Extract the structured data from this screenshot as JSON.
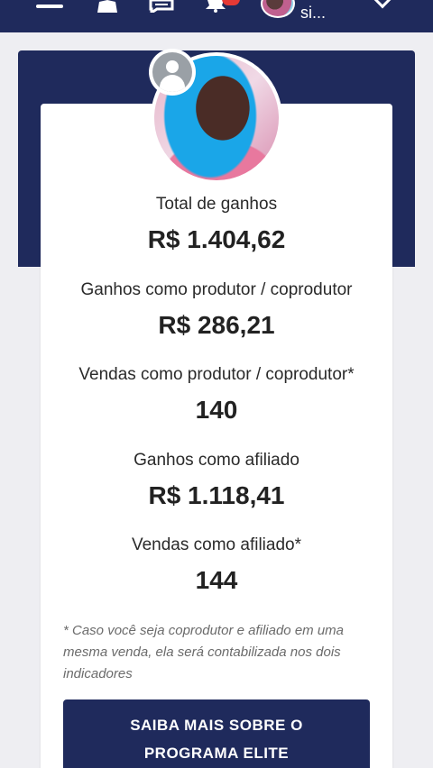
{
  "topbar": {
    "username": "si...",
    "icons": [
      "menu-icon",
      "people-icon",
      "chat-icon",
      "bell-icon",
      "chevron-down-icon"
    ],
    "colors": {
      "bar": "#1f2a5c",
      "notification": "#e53935"
    }
  },
  "stats": [
    {
      "label": "Total de ganhos",
      "value": "R$ 1.404,62"
    },
    {
      "label": "Ganhos como produtor / coprodutor",
      "value": "R$ 286,21"
    },
    {
      "label": "Vendas como produtor / coprodutor*",
      "value": "140"
    },
    {
      "label": "Ganhos como afiliado",
      "value": "R$ 1.118,41"
    },
    {
      "label": "Vendas como afiliado*",
      "value": "144"
    }
  ],
  "note": "* Caso você seja coprodutor e afiliado em uma mesma venda, ela será contabilizada nos dois indicadores",
  "cta": {
    "line1": "SAIBA MAIS SOBRE O",
    "line2": "PROGRAMA ELITE"
  }
}
